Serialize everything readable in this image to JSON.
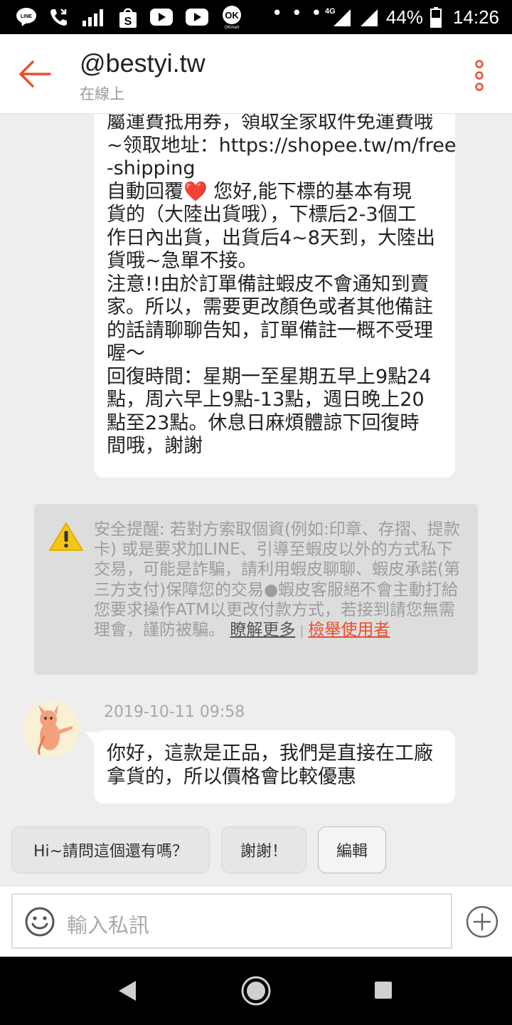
{
  "status_bar": {
    "icons": [
      "line-icon",
      "missed-call-icon",
      "signal-bars-icon",
      "shopee-icon",
      "youtube-icon",
      "youtube-icon",
      "okmart-icon"
    ],
    "more_dots": "• • •",
    "network": "4G",
    "battery": "44%",
    "time": "14:26"
  },
  "header": {
    "title": "@bestyi.tw",
    "status": "在線上"
  },
  "messages": [
    {
      "lines": [
        "屬運費抵用券，領取全家取件免運費哦",
        "~领取地址：https://shopee.tw/m/free",
        "-shipping",
        "自動回覆❤️  您好,能下標的基本有現",
        "貨的（大陸出貨哦），下標后2-3個工",
        "作日內出貨，出貨后4~8天到，大陸出",
        "貨哦~急單不接。",
        "注意!!由於訂單備註蝦皮不會通知到賣",
        "家。所以，需要更改顏色或者其他備註",
        "的話請聊聊告知，訂單備註一概不受理",
        "喔～",
        "回復時間：星期一至星期五早上9點24",
        "點，周六早上9點-13點，週日晚上20",
        "點至23點。休息日麻煩體諒下回復時",
        "間哦，謝謝"
      ]
    }
  ],
  "safety_notice": {
    "text": "安全提醒: 若對方索取個資(例如:印章、存摺、提款卡) 或是要求加LINE、引導至蝦皮以外的方式私下交易，可能是詐騙，請利用蝦皮聊聊、蝦皮承諾(第三方支付)保障您的交易●蝦皮客服絕不會主動打給您要求操作ATM以更改付款方式，若接到請您無需理會，謹防被騙。",
    "learn_more": "瞭解更多",
    "separator": "|",
    "report": "檢舉使用者"
  },
  "reply": {
    "timestamp": "2019-10-11 09:58",
    "lines": [
      "你好，這款是正品，我們是直接在工廠",
      "拿貨的，所以價格會比較優惠"
    ]
  },
  "quick_replies": [
    "Hi~請問這個還有嗎？",
    "謝謝！",
    "編輯"
  ],
  "input": {
    "placeholder": "輸入私訊"
  },
  "colors": {
    "accent": "#ee4d2d",
    "warning": "#f5c518"
  }
}
